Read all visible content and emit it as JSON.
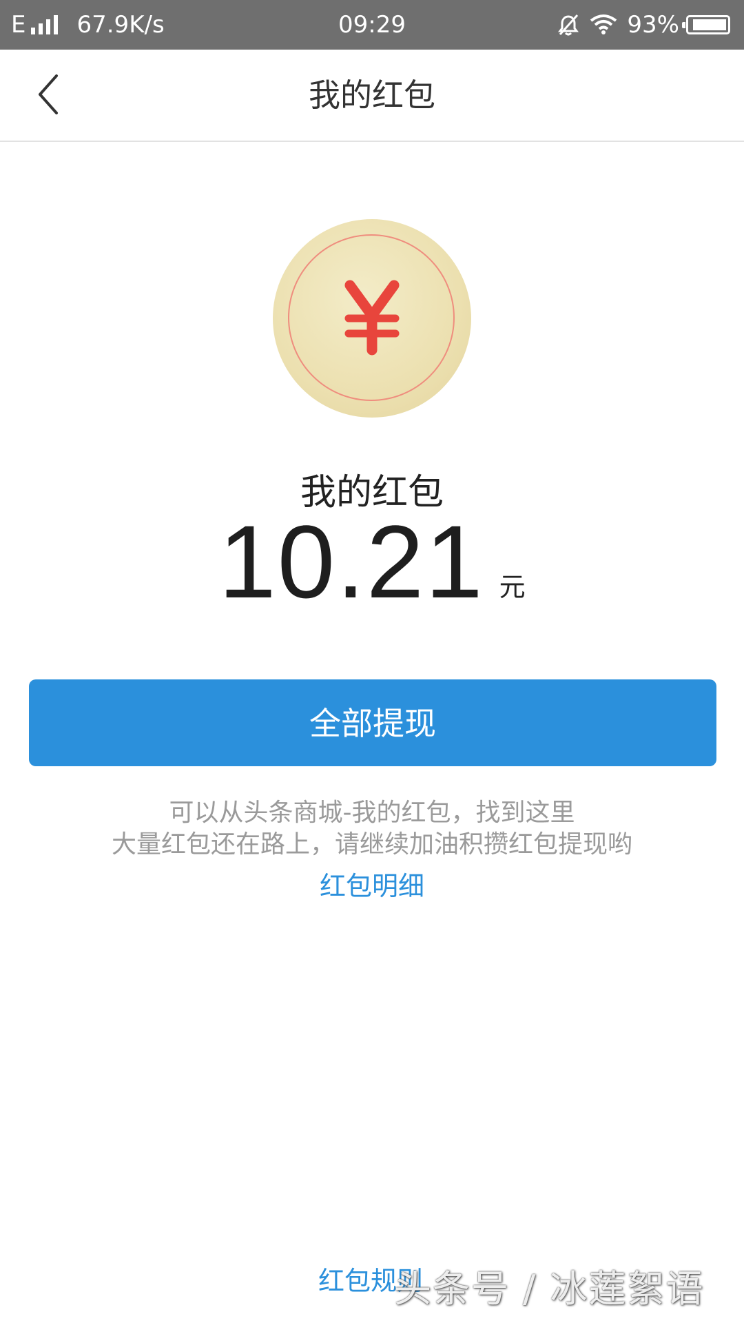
{
  "status_bar": {
    "network_type": "E",
    "speed": "67.9K/s",
    "time": "09:29",
    "battery": "93%",
    "battery_level": 0.93
  },
  "nav": {
    "back_icon": "chevron-left-icon",
    "title": "我的红包"
  },
  "coin": {
    "icon": "yen-icon",
    "colors": {
      "coin": "#ece0b0",
      "ring": "#ef8d7e",
      "symbol": "#e8453c"
    }
  },
  "wallet": {
    "label": "我的红包",
    "amount": "10.21",
    "unit": "元"
  },
  "withdraw_button": {
    "label": "全部提现",
    "color": "#2b90dc"
  },
  "hints": {
    "line1": "可以从头条商城-我的红包，找到这里",
    "line2": "大量红包还在路上，请继续加油积攒红包提现哟"
  },
  "links": {
    "detail": "红包明细",
    "rules": "红包规则"
  },
  "watermark": "头条号 / 冰莲絮语"
}
